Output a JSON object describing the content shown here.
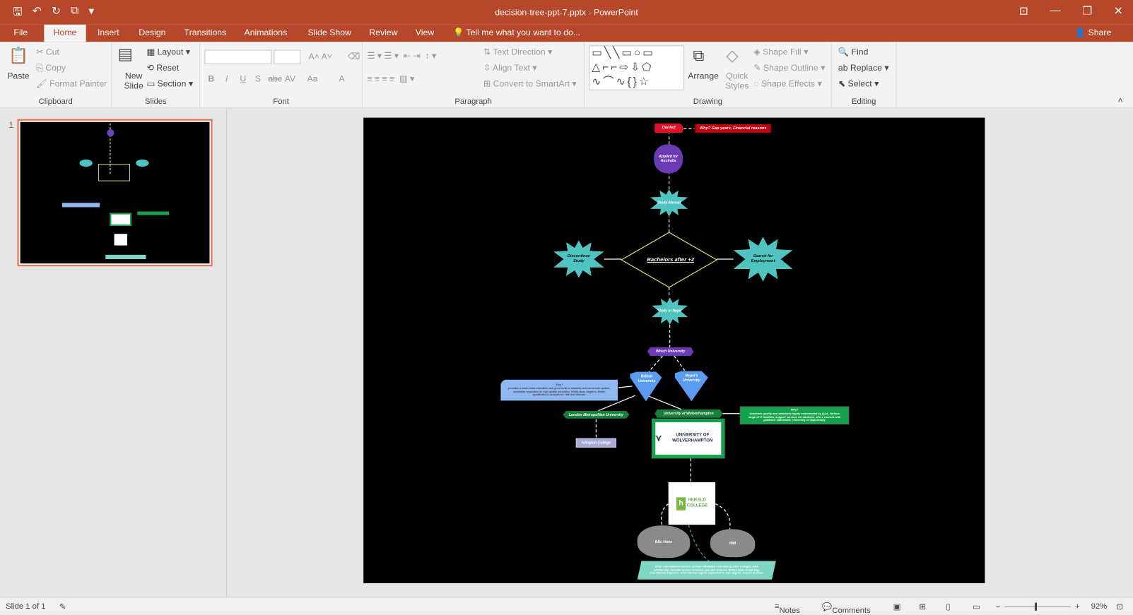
{
  "window": {
    "title": "decision-tree-ppt-7.pptx - PowerPoint",
    "share": "Share"
  },
  "tabs": [
    "File",
    "Home",
    "Insert",
    "Design",
    "Transitions",
    "Animations",
    "Slide Show",
    "Review",
    "View"
  ],
  "tell_me": "Tell me what you want to do...",
  "ribbon": {
    "clipboard": {
      "label": "Clipboard",
      "paste": "Paste",
      "cut": "Cut",
      "copy": "Copy",
      "format_painter": "Format Painter"
    },
    "slides": {
      "label": "Slides",
      "new_slide": "New Slide",
      "layout": "Layout",
      "reset": "Reset",
      "section": "Section"
    },
    "font": {
      "label": "Font",
      "bold": "B",
      "italic": "I",
      "underline": "U",
      "shadow": "S",
      "strike": "abc",
      "spacing": "AV",
      "case": "Aa",
      "color": "A"
    },
    "paragraph": {
      "label": "Paragraph",
      "text_direction": "Text Direction",
      "align_text": "Align Text",
      "smartart": "Convert to SmartArt"
    },
    "drawing": {
      "label": "Drawing",
      "arrange": "Arrange",
      "quick_styles": "Quick Styles",
      "shape_fill": "Shape Fill",
      "shape_outline": "Shape Outline",
      "shape_effects": "Shape Effects"
    },
    "editing": {
      "label": "Editing",
      "find": "Find",
      "replace": "Replace",
      "select": "Select"
    }
  },
  "thumbnail": {
    "number": "1"
  },
  "slide": {
    "denied": "Denied",
    "denied_why": "Why?   Gap years, Financial reasons",
    "applied": "Applied for Australia",
    "study_abroad": "Study Abroad",
    "decision": "Bachelors after +2",
    "discontinue": "Discontinue Study",
    "employment": "Search for Employment",
    "study_nepal": "Study in Nepal",
    "which_university": "Which University",
    "british": "British University",
    "nepals": "Nepal's University",
    "british_why": "Why?\nprovides a world-class education and great skills to students and curriculum system, worldwide reputation for high quality education, World-class degrees, British qualifications accepted in Yale and Harvard",
    "london_met": "London Metropolitan University",
    "islington": "Islington College",
    "wolverhampton": "University of Wolverhampton",
    "wolverhampton_logo": "UNIVERSITY OF WOLVERHAMPTON",
    "wolverhampton_why": "Why?\nAcademic quality and standards highly commended by QAA, Various range of IT facilities, support services for students, offers courses with guidance nationwide, University of Opportunity",
    "herald_logo": "HERALD COLLEGE",
    "bsc": "BSc Hons",
    "ibm": "IBM",
    "herald_why": "Why? International courses at most affordable cost among other colleges, AAA scholarship, Flexible Course structure and own lectures, British style of learning, International exposure, International degree equivalent to TU's degree, Course duration"
  },
  "status": {
    "slide": "Slide 1 of 1",
    "notes": "Notes",
    "comments": "Comments",
    "zoom": "92%"
  },
  "colors": {
    "accent": "#b7472a",
    "teal": "#4fc3c0",
    "purple": "#6a3bb5",
    "green": "#1a7f3c"
  }
}
